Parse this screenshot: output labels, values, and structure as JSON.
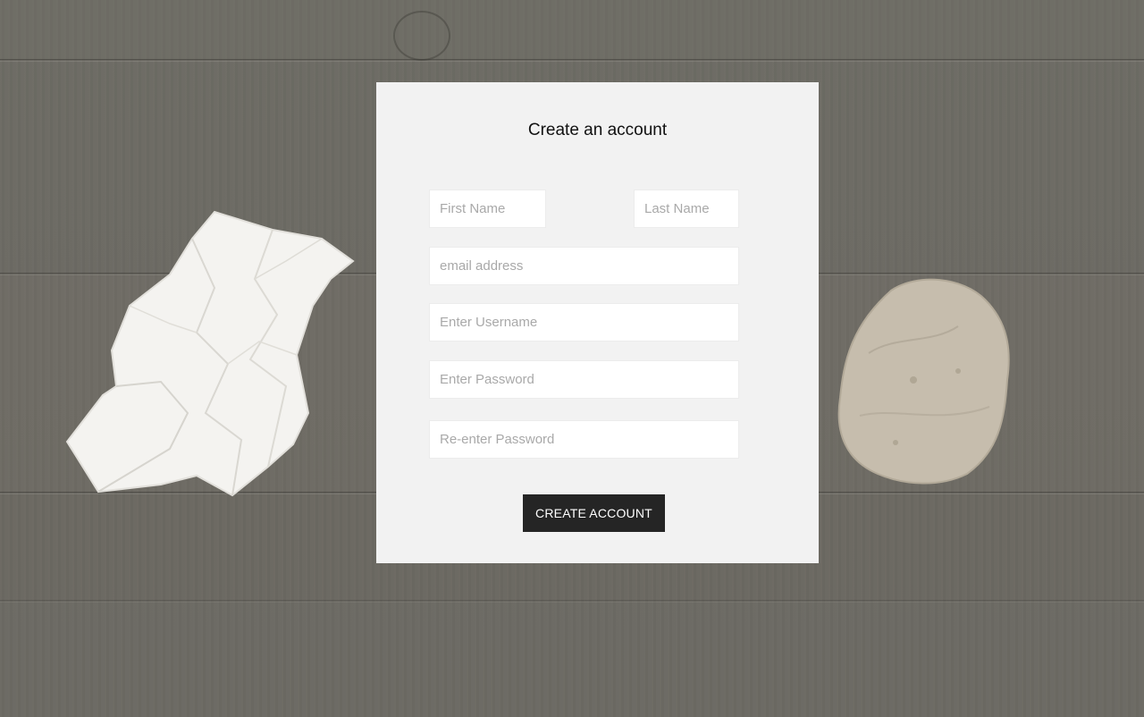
{
  "form": {
    "title": "Create an account",
    "fields": {
      "first_name": {
        "placeholder": "First Name",
        "value": ""
      },
      "last_name": {
        "placeholder": "Last Name",
        "value": ""
      },
      "email": {
        "placeholder": "email address",
        "value": ""
      },
      "username": {
        "placeholder": "Enter Username",
        "value": ""
      },
      "password": {
        "placeholder": "Enter Password",
        "value": ""
      },
      "password_confirm": {
        "placeholder": "Re-enter Password",
        "value": ""
      }
    },
    "submit_label": "CREATE ACCOUNT"
  },
  "colors": {
    "card_background": "#f2f2f2",
    "button_background": "#252525",
    "button_text": "#ffffff",
    "wood_background": "#6d6b64"
  },
  "decorations": {
    "left_object": "crumpled-paper",
    "right_object": "rock"
  }
}
